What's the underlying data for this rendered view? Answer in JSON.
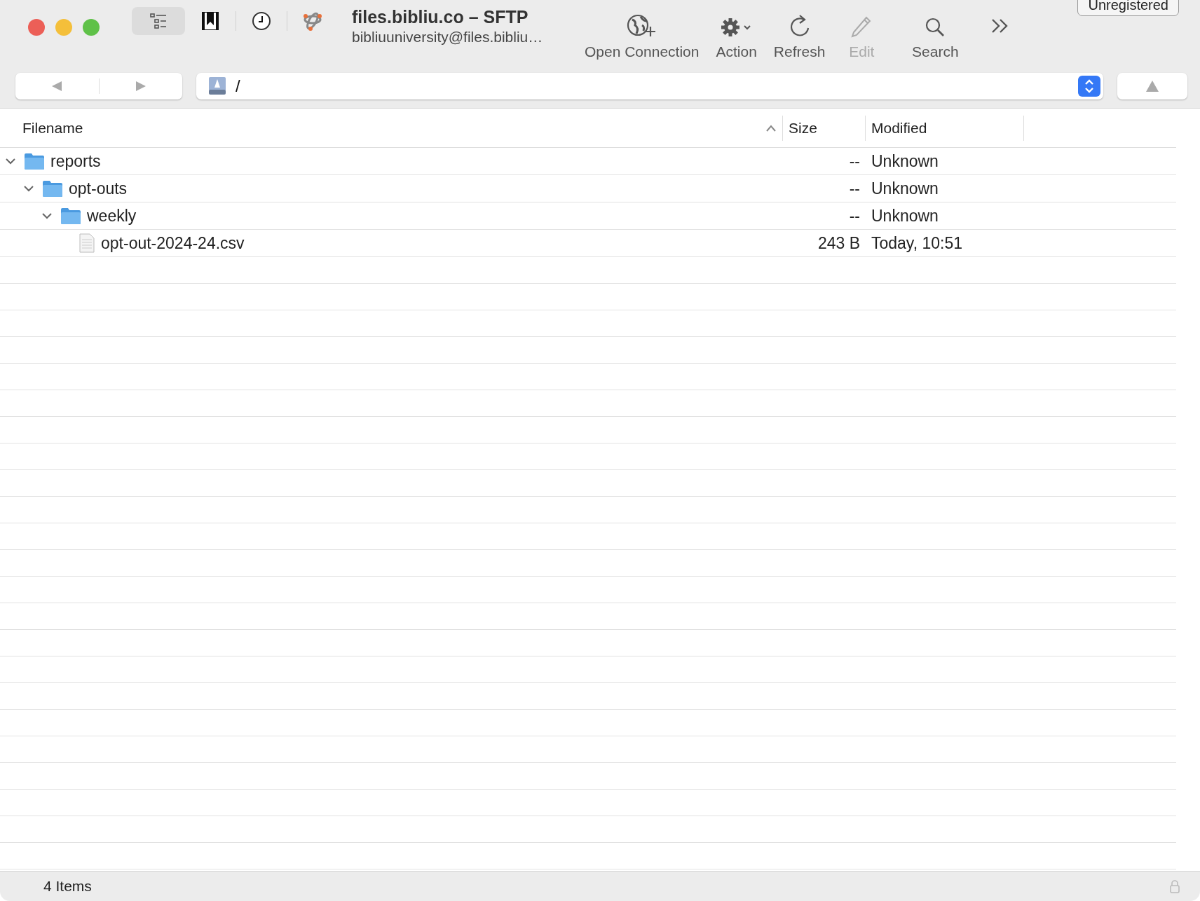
{
  "window": {
    "title": "files.bibliu.co – SFTP",
    "subtitle": "bibliuuniversity@files.bibliu…",
    "badge": "Unregistered"
  },
  "view_buttons": [
    {
      "kind": "outline",
      "selected": true
    },
    {
      "kind": "bookmarks",
      "selected": false
    },
    {
      "kind": "history",
      "selected": false
    },
    {
      "kind": "bonjour",
      "selected": false
    }
  ],
  "toolbar": [
    {
      "kind": "open-connection",
      "label": "Open Connection",
      "disabled": false
    },
    {
      "kind": "action",
      "label": "Action",
      "disabled": false
    },
    {
      "kind": "refresh",
      "label": "Refresh",
      "disabled": false
    },
    {
      "kind": "edit",
      "label": "Edit",
      "disabled": true
    },
    {
      "kind": "search",
      "label": "Search",
      "disabled": false
    }
  ],
  "path": {
    "value": "/"
  },
  "table": {
    "columns": [
      {
        "label": "Filename",
        "sorted": true
      },
      {
        "label": "Size",
        "sorted": false
      },
      {
        "label": "Modified",
        "sorted": false
      }
    ],
    "rows": [
      {
        "kind": "folder",
        "name": "reports",
        "size": "--",
        "modified": "Unknown",
        "expanded": true,
        "children": [
          {
            "kind": "folder",
            "name": "opt-outs",
            "size": "--",
            "modified": "Unknown",
            "expanded": true,
            "children": [
              {
                "kind": "folder",
                "name": "weekly",
                "size": "--",
                "modified": "Unknown",
                "expanded": true,
                "children": [
                  {
                    "kind": "file",
                    "name": "opt-out-2024-24.csv",
                    "size": "243 B",
                    "modified": "Today, 10:51"
                  }
                ]
              }
            ]
          }
        ]
      }
    ]
  },
  "status_bar": {
    "text": "4 Items"
  }
}
